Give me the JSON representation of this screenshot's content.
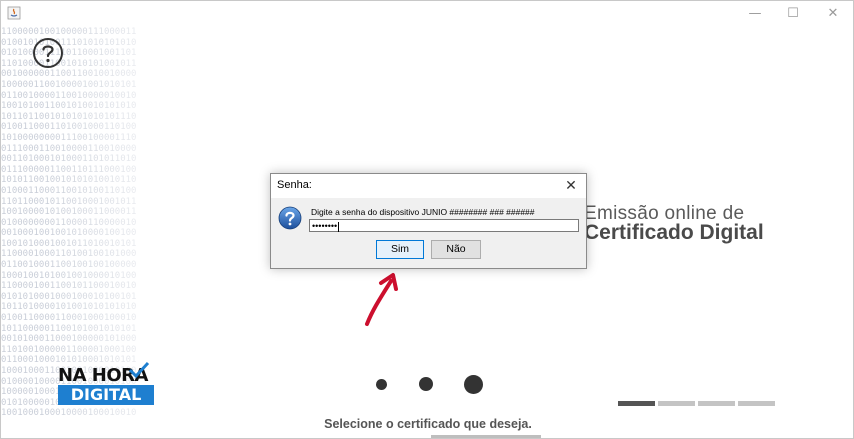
{
  "window": {
    "minimize_glyph": "—",
    "maximize_glyph": "☐",
    "close_glyph": "✕"
  },
  "background": {
    "binary_lines": [
      "1100000100100000111000011",
      "0100101010011101010101010",
      "0101000011110110001001101",
      "1101000011001010101001011",
      "0010000001100110010010000",
      "1000001100100001001010101",
      "0110010000110010000010010",
      "1001010011001010010101010",
      "1011011001010101010101110",
      "0100110001101001000110100",
      "1010000000011100100001110",
      "0111000110010000110010000",
      "0011010001010001101011010",
      "0111000001100110111000100",
      "1010110010010101010010110",
      "0100011000110010100110100",
      "1101100010110010001001011",
      "1001000010100100011000011",
      "0100000000110000110000010",
      "0010001001001010000100100",
      "1001010001001011010010101",
      "1100001000110100100101000",
      "0110010001100100100100000",
      "1000100101001001000010100",
      "1100001001100101100010010",
      "0101010001000100010100101",
      "1011010000101001010101010",
      "0100110000110001000100010",
      "1011000001100101001010101",
      "0010100011000100000101000",
      "1101001000001100001000100",
      "0110001000101010001010101",
      "1000100011001001000010100",
      "0100001000011001000010100",
      "1000001000100001000010010",
      "0101000001001000100010010",
      "1001000100010000100010010"
    ]
  },
  "help": {
    "icon": "question-circle-icon"
  },
  "brand": {
    "line1": "Emissão online de",
    "line2": "Certificado Digital"
  },
  "logo": {
    "top_text": "NA HORA",
    "bottom_text": "DIGITAL",
    "color_primary": "#1e7fd0"
  },
  "dots": {
    "count": 3
  },
  "progress": {
    "segments": 4,
    "active_segment": 1
  },
  "footer": {
    "text": "Selecione o certificado que deseja."
  },
  "dialog": {
    "title": "Senha:",
    "close_glyph": "✕",
    "message": "Digite a senha do dispositivo JUNIO ######## ### ######",
    "password_value": "••••••••",
    "buttons": {
      "yes": "Sim",
      "no": "Não"
    }
  },
  "colors": {
    "accent": "#0078d7",
    "arrow": "#cc0f2e",
    "brand_text": "#4a4a4a"
  }
}
